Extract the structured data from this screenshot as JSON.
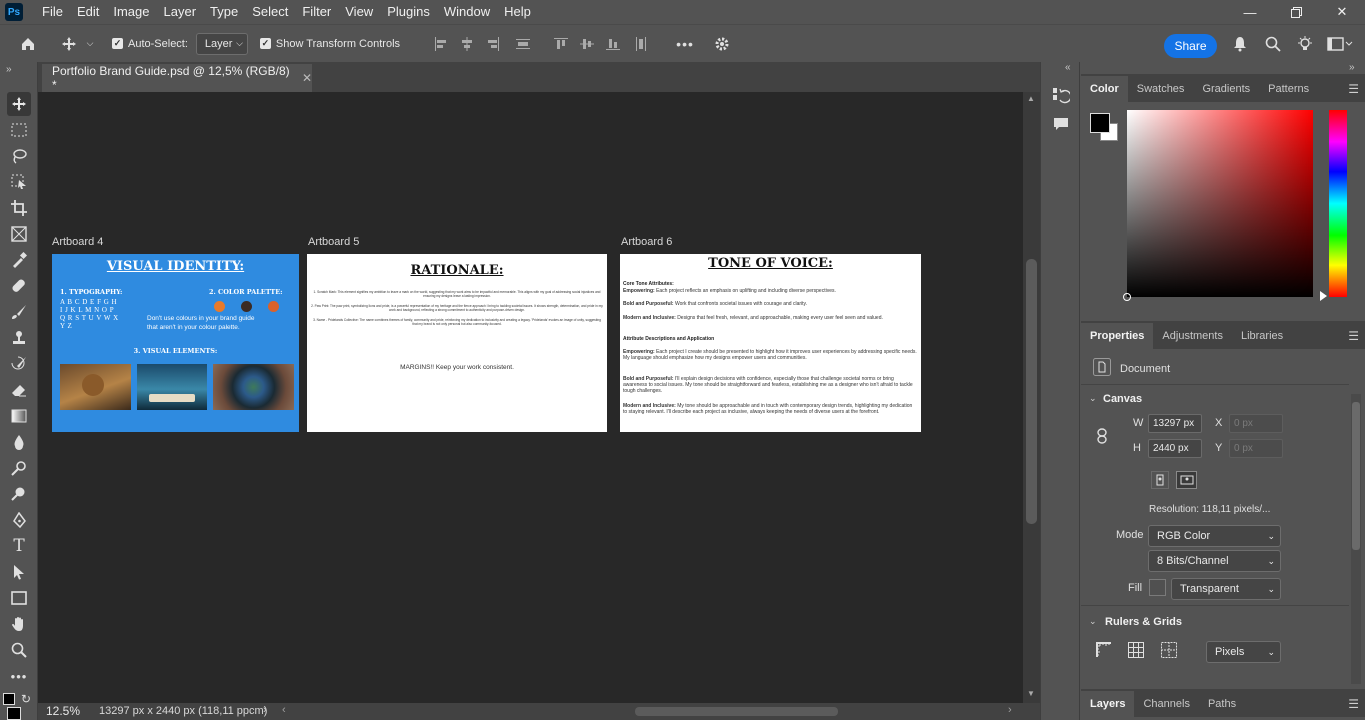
{
  "app": {
    "logo_text": "Ps"
  },
  "menu": [
    "File",
    "Edit",
    "Image",
    "Layer",
    "Type",
    "Select",
    "Filter",
    "View",
    "Plugins",
    "Window",
    "Help"
  ],
  "options_bar": {
    "auto_select_label": "Auto-Select:",
    "auto_select_value": "Layer",
    "show_transform_label": "Show Transform Controls",
    "share_label": "Share"
  },
  "document": {
    "tab_title": "Portfolio Brand Guide.psd @ 12,5% (RGB/8) *",
    "zoom": "12.5%",
    "status": "13297 px x 2440 px (118,11 ppcm)"
  },
  "artboards": [
    {
      "label": "Artboard 4",
      "title": "VISUAL IDENTITY:",
      "typography_heading": "1. TYPOGRAPHY:",
      "alphabet": "A B C D E F G H\nI J K L M N O P\nQ R S T U V W X\nY Z",
      "palette_heading": "2. COLOR PALETTE:",
      "palette_colors": [
        "#e87a2a",
        "#3b2b24",
        "#d9622b"
      ],
      "palette_note": "Don't use colours in your brand guide that aren't in your colour palette.",
      "elements_heading": "3. VISUAL ELEMENTS:"
    },
    {
      "label": "Artboard 5",
      "title": "RATIONALE:",
      "lines": [
        "1. Scratch Mark: This element signifies my ambition to leave a mark on the world, suggesting that my work aims to be impactful and memorable. This aligns with my goal of addressing social injustices and ensuring my designs leave a lasting impression.",
        "2. Paw Print: The paw print, symbolizing lions and pride, is a powerful representation of my heritage and the fierce approach I bring to tackling societal issues. It shows strength, determination, and pride in my work and background, reflecting a strong commitment to authenticity and purpose-driven design.",
        "3. Name - Pridelands Collective: The name combines themes of family, community and pride, reinforcing my dedication to inclusivity and creating a legacy. 'Pridelands' evokes an image of unity, suggesting that my brand is not only personal but also community-focused."
      ],
      "note": "MARGINS!! Keep your work consistent."
    },
    {
      "label": "Artboard 6",
      "title": "TONE OF VOICE:",
      "core_heading": "Core Tone Attributes:",
      "core": [
        {
          "term": "Empowering:",
          "text": "Each project reflects an emphasis on uplifting and including diverse perspectives."
        },
        {
          "term": "Bold and Purposeful:",
          "text": "Work that confronts societal issues with courage and clarity."
        },
        {
          "term": "Modern and Inclusive:",
          "text": "Designs that feel fresh, relevant, and approachable, making every user feel seen and valued."
        }
      ],
      "attr_heading": "Attribute Descriptions and Application",
      "attrs": [
        {
          "term": "Empowering:",
          "text": "Each project I create should be presented to highlight how it improves user experiences by addressing specific needs. My language should emphasize how my designs empower users and communities."
        },
        {
          "term": "Bold and Purposeful:",
          "text": "I'll explain design decisions with confidence, especially those that challenge societal norms or bring awareness to social issues. My tone should be straightforward and fearless, establishing me as a designer who isn't afraid to tackle tough challenges."
        },
        {
          "term": "Modern and Inclusive:",
          "text": "My tone should be approachable and in touch with contemporary design trends, highlighting my dedication to staying relevant. I'll describe each project as inclusive, always keeping the needs of diverse users at the forefront."
        }
      ]
    }
  ],
  "color_panel": {
    "tabs": [
      "Color",
      "Swatches",
      "Gradients",
      "Patterns"
    ],
    "foreground": "#000000",
    "background": "#ffffff",
    "hue": "#ff0000"
  },
  "properties_panel": {
    "tabs": [
      "Properties",
      "Adjustments",
      "Libraries"
    ],
    "doc_label": "Document",
    "canvas_heading": "Canvas",
    "w_label": "W",
    "w_value": "13297 px",
    "h_label": "H",
    "h_value": "2440 px",
    "x_label": "X",
    "x_placeholder": "0 px",
    "y_label": "Y",
    "y_placeholder": "0 px",
    "resolution": "Resolution:  118,11  pixels/...",
    "mode_label": "Mode",
    "mode_value": "RGB Color",
    "depth_value": "8 Bits/Channel",
    "fill_label": "Fill",
    "fill_value": "Transparent",
    "rulers_heading": "Rulers & Grids",
    "units_value": "Pixels"
  },
  "layers_panel": {
    "tabs": [
      "Layers",
      "Channels",
      "Paths"
    ]
  }
}
